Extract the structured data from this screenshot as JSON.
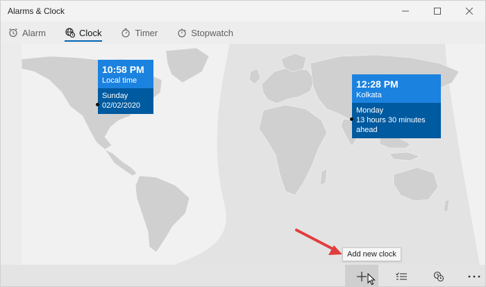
{
  "window": {
    "title": "Alarms & Clock"
  },
  "tabs": [
    {
      "label": "Alarm",
      "icon": "alarm-icon"
    },
    {
      "label": "Clock",
      "icon": "globe-clock-icon"
    },
    {
      "label": "Timer",
      "icon": "timer-icon"
    },
    {
      "label": "Stopwatch",
      "icon": "stopwatch-icon"
    }
  ],
  "clocks": [
    {
      "time": "10:58 PM",
      "label": "Local time",
      "day": "Sunday",
      "date": "02/02/2020"
    },
    {
      "time": "12:28 PM",
      "label": "Kolkata",
      "day": "Monday",
      "offset": "13 hours 30 minutes ahead"
    }
  ],
  "tooltip": "Add new clock",
  "commands": [
    {
      "icon": "plus-icon"
    },
    {
      "icon": "select-list-icon"
    },
    {
      "icon": "pin-to-start-icon"
    },
    {
      "icon": "more-icon"
    }
  ],
  "colors": {
    "accent": "#0063b1",
    "card_top": "#1b82e0",
    "card_bottom": "#005aa0",
    "annotation_arrow": "#e23d3d"
  }
}
